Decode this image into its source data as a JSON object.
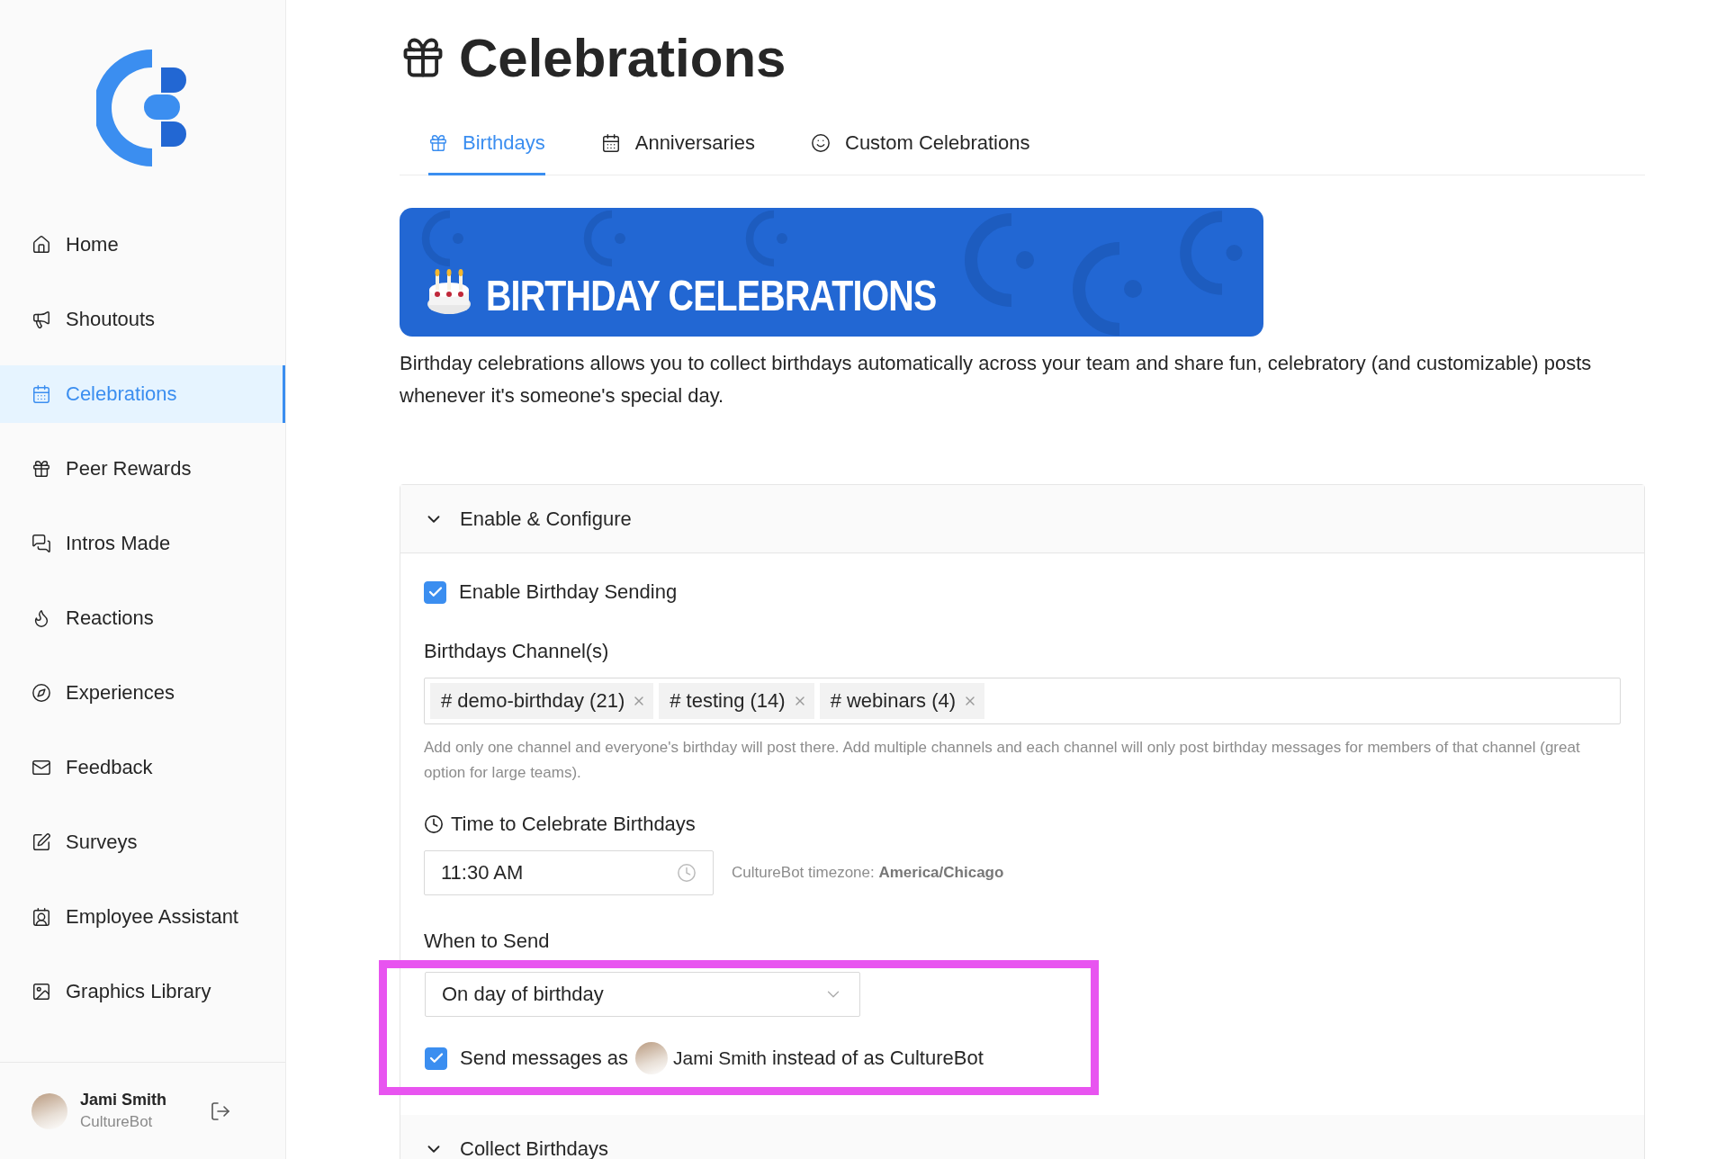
{
  "sidebar": {
    "items": [
      {
        "label": "Home",
        "selected": false
      },
      {
        "label": "Shoutouts",
        "selected": false
      },
      {
        "label": "Celebrations",
        "selected": true
      },
      {
        "label": "Peer Rewards",
        "selected": false
      },
      {
        "label": "Intros Made",
        "selected": false
      },
      {
        "label": "Reactions",
        "selected": false
      },
      {
        "label": "Experiences",
        "selected": false
      },
      {
        "label": "Feedback",
        "selected": false
      },
      {
        "label": "Surveys",
        "selected": false
      },
      {
        "label": "Employee Assistant",
        "selected": false
      },
      {
        "label": "Graphics Library",
        "selected": false
      }
    ],
    "user": {
      "name": "Jami Smith",
      "subtitle": "CultureBot"
    }
  },
  "page": {
    "title": "Celebrations"
  },
  "tabs": [
    {
      "label": "Birthdays",
      "selected": true
    },
    {
      "label": "Anniversaries",
      "selected": false
    },
    {
      "label": "Custom Celebrations",
      "selected": false
    }
  ],
  "banner": {
    "title": "BIRTHDAY CELEBRATIONS"
  },
  "description": "Birthday celebrations allows you to collect birthdays automatically across your team and share fun, celebratory (and customizable) posts whenever it's someone's special day.",
  "sections": [
    {
      "title": "Enable & Configure"
    },
    {
      "title": "Collect Birthdays"
    }
  ],
  "config": {
    "enable": {
      "label": "Enable Birthday Sending",
      "checked": true
    },
    "channels": {
      "label": "Birthdays Channel(s)",
      "tags": [
        "# demo-birthday (21)",
        "# testing (14)",
        "# webinars (4)"
      ],
      "hint": "Add only one channel and everyone's birthday will post there. Add multiple channels and each channel will only post birthday messages for members of that channel (great option for large teams)."
    },
    "time": {
      "label": "Time to Celebrate Birthdays",
      "value": "11:30 AM",
      "timezone": "CultureBot timezone: **America/Chicago**"
    },
    "when": {
      "label": "When to Send",
      "value": "On day of birthday",
      "highlighted": true
    },
    "send_as": {
      "checked": true,
      "before": "Send messages as",
      "user": "Jami Smith",
      "after": "instead of as CultureBot"
    }
  }
}
